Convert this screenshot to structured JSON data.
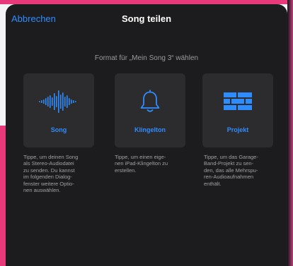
{
  "nav": {
    "cancel_label": "Abbrechen",
    "title": "Song teilen"
  },
  "subtitle": "Format für „Mein Song 3“ wählen",
  "options": [
    {
      "label": "Song",
      "icon": "waveform-icon",
      "description": "Tippe, um deinen Song\nals Stereo-Audiodatei\nzu senden. Du kannst\nim folgenden Dialog-\nfenster weitere Optio-\nnen auswählen."
    },
    {
      "label": "Klingelton",
      "icon": "bell-icon",
      "description": "Tippe, um einen eige-\nnen iPad-Klingelton zu\nerstellen."
    },
    {
      "label": "Projekt",
      "icon": "bricks-icon",
      "description": "Tippe, um das Garage-\nBand-Projekt zu sen-\nden, das alle Mehrspu-\nren-Audioaufnahmen\nenthält."
    }
  ],
  "colors": {
    "accent": "#2f8cff",
    "sheet_background": "#1c1c1e",
    "card_background": "#2c2c2e"
  }
}
